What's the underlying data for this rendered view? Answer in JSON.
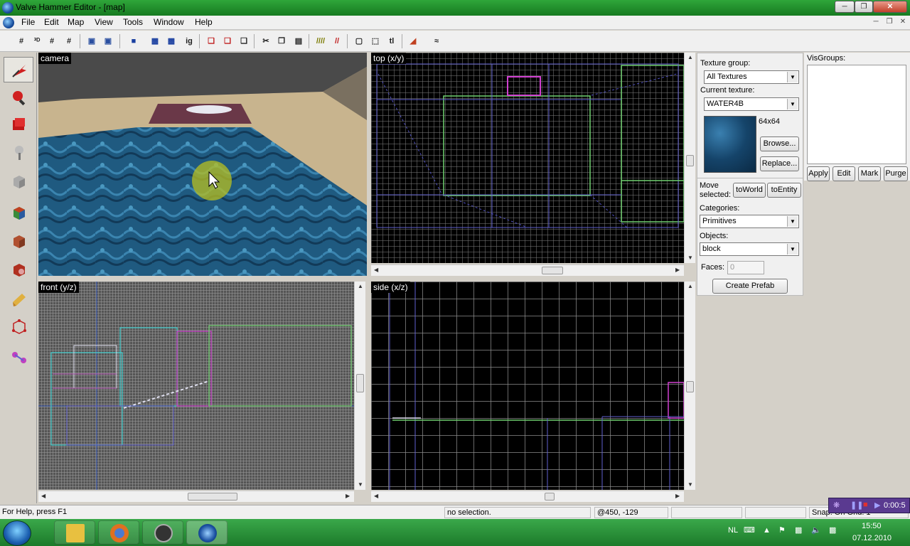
{
  "window": {
    "title": "Valve Hammer Editor - [map]"
  },
  "menu": [
    "File",
    "Edit",
    "Map",
    "View",
    "Tools",
    "Window",
    "Help"
  ],
  "viewports": {
    "camera": "camera",
    "top": "top (x/y)",
    "front": "front (y/z)",
    "side": "side (x/z)"
  },
  "texture_panel": {
    "group_label": "Texture group:",
    "group_value": "All Textures",
    "current_label": "Current texture:",
    "current_value": "WATER4B",
    "size": "64x64",
    "browse": "Browse...",
    "replace": "Replace...",
    "move_label_1": "Move",
    "move_label_2": "selected:",
    "to_world": "toWorld",
    "to_entity": "toEntity",
    "categories_label": "Categories:",
    "categories_value": "Primitives",
    "objects_label": "Objects:",
    "objects_value": "block",
    "faces_label": "Faces:",
    "faces_value": "0",
    "create_prefab": "Create Prefab"
  },
  "visgroups": {
    "label": "VisGroups:",
    "apply": "Apply",
    "edit": "Edit",
    "mark": "Mark",
    "purge": "Purge"
  },
  "status": {
    "help": "For Help, press F1",
    "selection": "no selection.",
    "coords": "@450, -129",
    "snap": "Snap: On Grid: 1"
  },
  "recorder": {
    "time": "0:00:5"
  },
  "tray": {
    "lang": "NL",
    "time": "15:50",
    "date": "07.12.2010"
  }
}
